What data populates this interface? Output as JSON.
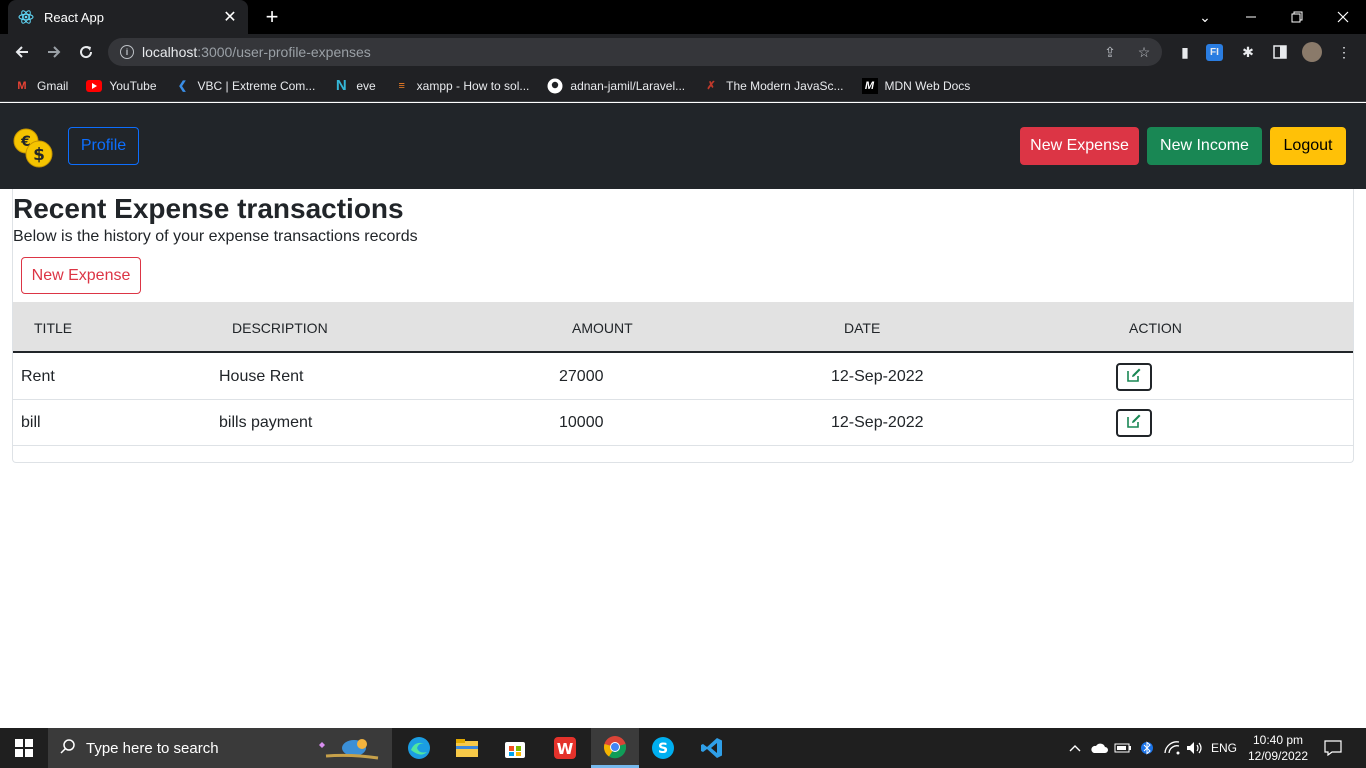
{
  "browser": {
    "tab_title": "React App",
    "tab_close": "✕",
    "new_tab": "+",
    "url_host": "localhost",
    "url_path": ":3000/user-profile-expenses",
    "bookmarks": [
      {
        "label": "Gmail",
        "icon": "gmail-icon"
      },
      {
        "label": "YouTube",
        "icon": "youtube-icon"
      },
      {
        "label": "VBC | Extreme Com...",
        "icon": "vbc-icon"
      },
      {
        "label": "eve",
        "icon": "eve-icon"
      },
      {
        "label": "xampp - How to sol...",
        "icon": "stackoverflow-icon"
      },
      {
        "label": "adnan-jamil/Laravel...",
        "icon": "github-icon"
      },
      {
        "label": "The Modern JavaSc...",
        "icon": "javascript-info-icon"
      },
      {
        "label": "MDN Web Docs",
        "icon": "mdn-icon"
      }
    ]
  },
  "navbar": {
    "profile_label": "Profile",
    "new_expense_label": "New Expense",
    "new_income_label": "New Income",
    "logout_label": "Logout"
  },
  "main": {
    "title": "Recent Expense transactions",
    "subtitle": "Below is the history of your expense transactions records",
    "new_expense_label": "New Expense",
    "table": {
      "headers": [
        "TITLE",
        "DESCRIPTION",
        "AMOUNT",
        "DATE",
        "ACTION"
      ],
      "rows": [
        {
          "title": "Rent",
          "description": "House Rent",
          "amount": "27000",
          "date": "12-Sep-2022"
        },
        {
          "title": "bill",
          "description": "bills payment",
          "amount": "10000",
          "date": "12-Sep-2022"
        }
      ]
    }
  },
  "taskbar": {
    "search_placeholder": "Type here to search",
    "language": "ENG",
    "time": "10:40 pm",
    "date": "12/09/2022"
  },
  "colors": {
    "danger": "#dc3545",
    "success": "#198754",
    "warning": "#ffc107",
    "primary": "#0d6efd",
    "navbar_bg": "#212529"
  }
}
